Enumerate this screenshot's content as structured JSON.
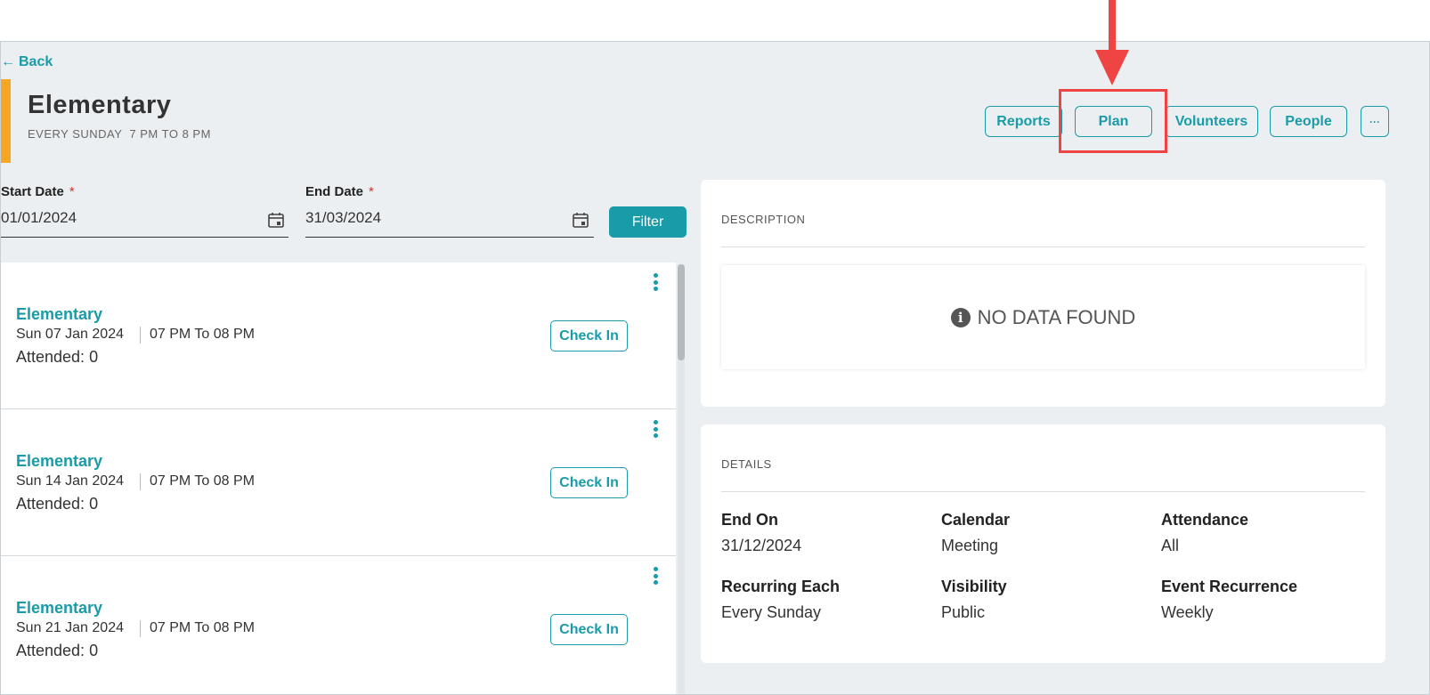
{
  "nav": {
    "back_label": "Back"
  },
  "header": {
    "title": "Elementary",
    "subtitle": "EVERY SUNDAY  7 PM TO 8 PM",
    "buttons": {
      "reports": "Reports",
      "plan": "Plan",
      "volunteers": "Volunteers",
      "people": "People",
      "more": "···"
    }
  },
  "filters": {
    "start": {
      "label": "Start Date",
      "required": "*",
      "value": "01/01/2024"
    },
    "end": {
      "label": "End Date",
      "required": "*",
      "value": "31/03/2024"
    },
    "filter_label": "Filter"
  },
  "events": [
    {
      "name": "Elementary",
      "date": "Sun 07 Jan  2024",
      "time": "07 PM To 08 PM",
      "attended": "Attended: 0",
      "checkin": "Check In"
    },
    {
      "name": "Elementary",
      "date": "Sun 14 Jan  2024",
      "time": "07 PM To 08 PM",
      "attended": "Attended: 0",
      "checkin": "Check In"
    },
    {
      "name": "Elementary",
      "date": "Sun 21 Jan  2024",
      "time": "07 PM To 08 PM",
      "attended": "Attended: 0",
      "checkin": "Check In"
    }
  ],
  "description": {
    "title": "DESCRIPTION",
    "empty_text": "NO DATA FOUND"
  },
  "details": {
    "title": "DETAILS",
    "end_on": {
      "label": "End On",
      "value": "31/12/2024"
    },
    "calendar": {
      "label": "Calendar",
      "value": "Meeting"
    },
    "attendance": {
      "label": "Attendance",
      "value": "All"
    },
    "recurring_each": {
      "label": "Recurring Each",
      "value": "Every Sunday"
    },
    "visibility": {
      "label": "Visibility",
      "value": "Public"
    },
    "event_recurrence": {
      "label": "Event Recurrence",
      "value": "Weekly"
    }
  },
  "colors": {
    "accent": "#1a9ba8",
    "highlight": "#ef4444",
    "bar": "#f5a623"
  },
  "icons": {
    "calendar": "calendar-icon",
    "info": "info-icon",
    "arrow": "arrow-down-icon"
  }
}
